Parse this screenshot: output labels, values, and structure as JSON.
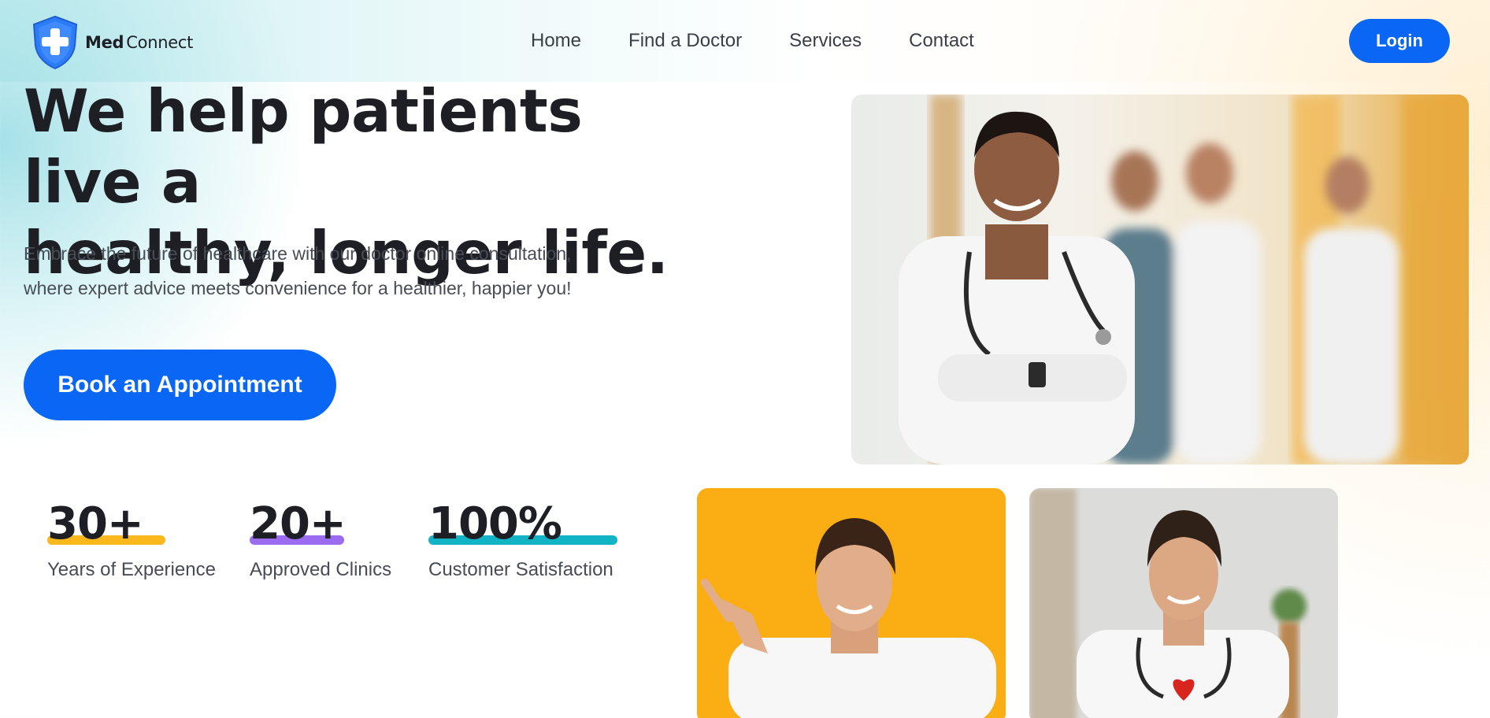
{
  "brand": {
    "name_bold": "Med",
    "name_light": "Connect",
    "logo_icon": "shield-cross-icon"
  },
  "nav": {
    "items": [
      {
        "label": "Home"
      },
      {
        "label": "Find a Doctor"
      },
      {
        "label": "Services"
      },
      {
        "label": "Contact"
      }
    ],
    "login_label": "Login"
  },
  "hero": {
    "title_line1": "We help patients live a",
    "title_line2": "healthy, longer life.",
    "subtitle_line1": "Embrace the future of healthcare with our doctor online consultation,",
    "subtitle_line2": "where expert advice meets convenience for a healthier, happier you!",
    "cta_label": "Book an Appointment"
  },
  "stats": [
    {
      "value": "30+",
      "label": "Years of Experience",
      "accent": "#fbb81c"
    },
    {
      "value": "20+",
      "label": "Approved Clinics",
      "accent": "#9b6cf0"
    },
    {
      "value": "100%",
      "label": "Customer Satisfaction",
      "accent": "#11b3c4"
    }
  ],
  "images": {
    "main": "team-of-doctors-photo",
    "left": "doctor-pointing-photo",
    "right": "doctor-holding-heart-photo"
  },
  "colors": {
    "primary": "#0a66f5",
    "text": "#1d1f24",
    "muted": "#474c55"
  }
}
